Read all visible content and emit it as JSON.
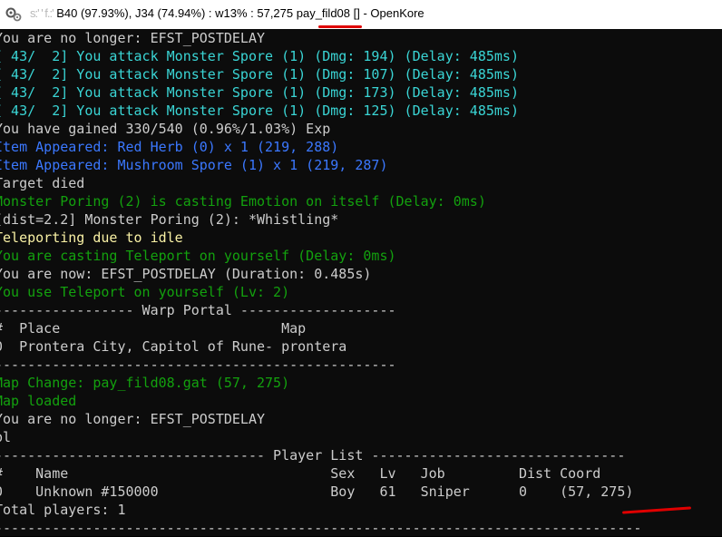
{
  "window": {
    "title_blurred": "s:' ' f.:'",
    "title_text": "B40 (97.93%), J34 (74.94%) : w13% : 57,275 pay_fild08 [] - OpenKore"
  },
  "lines": [
    {
      "text": "You are no longer: EFST_POSTDELAY",
      "color": "white"
    },
    {
      "text": "[ 43/  2] You attack Monster Spore (1) (Dmg: 194) (Delay: 485ms)",
      "color": "cyan"
    },
    {
      "text": "[ 43/  2] You attack Monster Spore (1) (Dmg: 107) (Delay: 485ms)",
      "color": "cyan"
    },
    {
      "text": "[ 43/  2] You attack Monster Spore (1) (Dmg: 173) (Delay: 485ms)",
      "color": "cyan"
    },
    {
      "text": "[ 43/  2] You attack Monster Spore (1) (Dmg: 125) (Delay: 485ms)",
      "color": "cyan"
    },
    {
      "text": "You have gained 330/540 (0.96%/1.03%) Exp",
      "color": "white"
    },
    {
      "text": "Item Appeared: Red Herb (0) x 1 (219, 288)",
      "color": "blue"
    },
    {
      "text": "Item Appeared: Mushroom Spore (1) x 1 (219, 287)",
      "color": "blue"
    },
    {
      "text": "Target died",
      "color": "white"
    },
    {
      "text": "Monster Poring (2) is casting Emotion on itself (Delay: 0ms)",
      "color": "green"
    },
    {
      "text": "[dist=2.2] Monster Poring (2): *Whistling*",
      "color": "white"
    },
    {
      "text": "Teleporting due to idle",
      "color": "yellow"
    },
    {
      "text": "You are casting Teleport on yourself (Delay: 0ms)",
      "color": "green"
    },
    {
      "text": "You are now: EFST_POSTDELAY (Duration: 0.485s)",
      "color": "white"
    },
    {
      "text": "You use Teleport on yourself (Lv: 2)",
      "color": "green"
    },
    {
      "text": "----------------- Warp Portal -------------------",
      "color": "white"
    },
    {
      "text": "#  Place                           Map",
      "color": "white"
    },
    {
      "text": "0  Prontera City, Capitol of Rune- prontera",
      "color": "white"
    },
    {
      "text": "-------------------------------------------------",
      "color": "white"
    },
    {
      "text": "Map Change: pay_fild08.gat (57, 275)",
      "color": "green"
    },
    {
      "text": "Map loaded",
      "color": "green"
    },
    {
      "text": "You are no longer: EFST_POSTDELAY",
      "color": "white"
    },
    {
      "text": "pl",
      "color": "white"
    },
    {
      "text": "--------------------------------- Player List -------------------------------",
      "color": "white"
    },
    {
      "text": "#    Name                                Sex   Lv   Job         Dist Coord",
      "color": "white"
    },
    {
      "text": "0    Unknown #150000                     Boy   61   Sniper      0    (57, 275)",
      "color": "white"
    },
    {
      "text": "Total players: 1",
      "color": "white"
    },
    {
      "text": "-------------------------------------------------------------------------------",
      "color": "white"
    }
  ],
  "colors": {
    "background": "#0c0c0c",
    "white": "#cccccc",
    "cyan": "#3ad5d5",
    "blue": "#3b78ff",
    "green": "#13a10e",
    "yellow": "#f9f1a5",
    "annotation": "#e00000"
  },
  "icons": {
    "app": "openkore-gear-icon"
  }
}
